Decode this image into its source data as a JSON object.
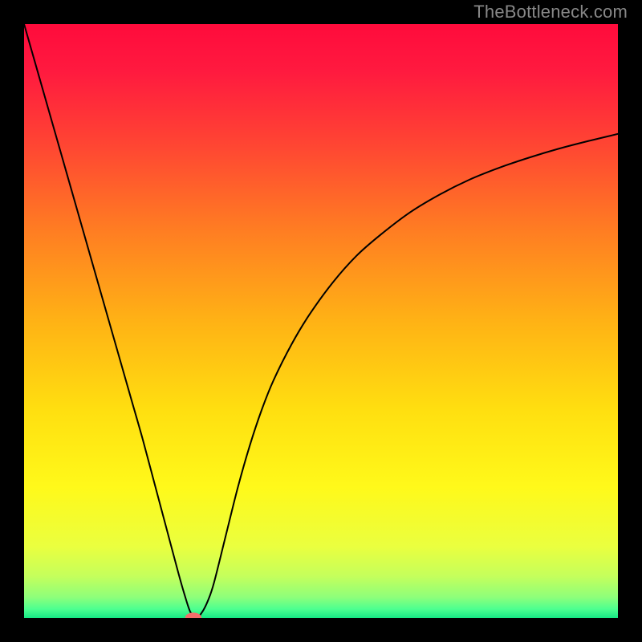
{
  "watermark": "TheBottleneck.com",
  "chart_data": {
    "type": "line",
    "title": "",
    "xlabel": "",
    "ylabel": "",
    "xlim": [
      0,
      100
    ],
    "ylim": [
      0,
      100
    ],
    "background_gradient": {
      "stops": [
        {
          "offset": 0.0,
          "color": "#ff0b3c"
        },
        {
          "offset": 0.08,
          "color": "#ff1a3f"
        },
        {
          "offset": 0.2,
          "color": "#ff4433"
        },
        {
          "offset": 0.35,
          "color": "#ff7e22"
        },
        {
          "offset": 0.5,
          "color": "#ffb215"
        },
        {
          "offset": 0.65,
          "color": "#ffdf10"
        },
        {
          "offset": 0.78,
          "color": "#fff91a"
        },
        {
          "offset": 0.88,
          "color": "#eaff3f"
        },
        {
          "offset": 0.93,
          "color": "#c4ff5c"
        },
        {
          "offset": 0.965,
          "color": "#8eff7a"
        },
        {
          "offset": 0.985,
          "color": "#4dff90"
        },
        {
          "offset": 1.0,
          "color": "#17e884"
        }
      ]
    },
    "series": [
      {
        "name": "bottleneck-curve",
        "color": "#000000",
        "stroke_width": 2,
        "x": [
          0,
          2,
          4,
          6,
          8,
          10,
          12,
          14,
          16,
          18,
          20,
          22,
          24,
          26,
          27,
          28,
          29,
          30,
          31,
          32,
          34,
          36,
          38,
          40,
          42,
          45,
          48,
          52,
          56,
          60,
          65,
          70,
          75,
          80,
          85,
          90,
          95,
          100
        ],
        "y": [
          100,
          93,
          86,
          79,
          72,
          65,
          58,
          51,
          44,
          37,
          30,
          22.5,
          15,
          7.5,
          4,
          1,
          0,
          1,
          3,
          6,
          14,
          22,
          29,
          35,
          40,
          46,
          51,
          56.5,
          61,
          64.5,
          68.3,
          71.3,
          73.8,
          75.8,
          77.5,
          79,
          80.3,
          81.5
        ]
      }
    ],
    "markers": [
      {
        "name": "optimum-marker",
        "x": 28.5,
        "y": 0,
        "rx": 1.4,
        "ry": 0.9,
        "color": "#f26d6a"
      }
    ]
  }
}
